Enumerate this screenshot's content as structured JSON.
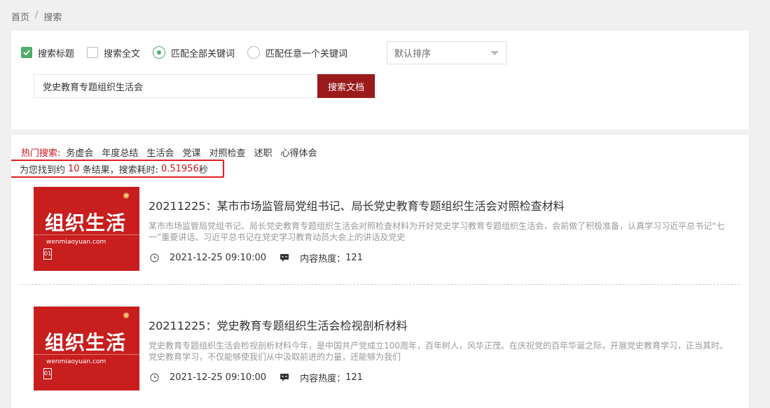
{
  "breadcrumb": {
    "home": "首页",
    "sep": "/",
    "current": "搜索"
  },
  "options": {
    "search_title": "搜索标题",
    "search_fulltext": "搜索全文",
    "match_all": "匹配全部关键词",
    "match_any": "匹配任意一个关键词"
  },
  "sort": {
    "selected": "默认排序"
  },
  "search": {
    "value": "党史教育专题组织生活会",
    "button": "搜索文档"
  },
  "hot": {
    "label": "热门搜索:",
    "tags": [
      "务虚会",
      "年度总结",
      "生活会",
      "党课",
      "对照检查",
      "述职",
      "心得体会"
    ]
  },
  "stats": {
    "prefix": "为您找到约",
    "count": "10",
    "middle": "条结果，搜索耗时:",
    "time": "0.51956",
    "suffix": "秒"
  },
  "results": [
    {
      "thumb_title": "组织生活",
      "thumb_url": "wenmiaoyuan.com",
      "thumb_num": "01",
      "title": "20211225：某市市场监管局党组书记、局长党史教育专题组织生活会对照检查材料",
      "desc": "某市市场监管局党组书记、局长党史教育专题组织生活会对照检查材料为开好党史学习教育专题组织生活会，会前做了积极准备，认真学习习近平总书记“七一”重要讲话、习近平总书记在党史学习教育动员大会上的讲话及党史",
      "date": "2021-12-25 09:10:00",
      "heat_label": "内容热度：",
      "heat": "121"
    },
    {
      "thumb_title": "组织生活",
      "thumb_url": "wenmiaoyuan.com",
      "thumb_num": "01",
      "title": "20211225：党史教育专题组织生活会检视剖析材料",
      "desc": "党史教育专题组织生活会检视剖析材料今年，是中国共产党成立100周年，百年树人，风华正茂。在庆祝党的百年华诞之际，开展党史教育学习，正当其时。党史教育学习，不仅能够使我们从中汲取前进的力量，还能够为我们",
      "date": "2021-12-25 09:10:00",
      "heat_label": "内容热度：",
      "heat": "121"
    }
  ],
  "colors": {
    "brand_red": "#9b1a1c",
    "accent_green": "#4caf6a",
    "highlight_red": "#c9161c"
  }
}
